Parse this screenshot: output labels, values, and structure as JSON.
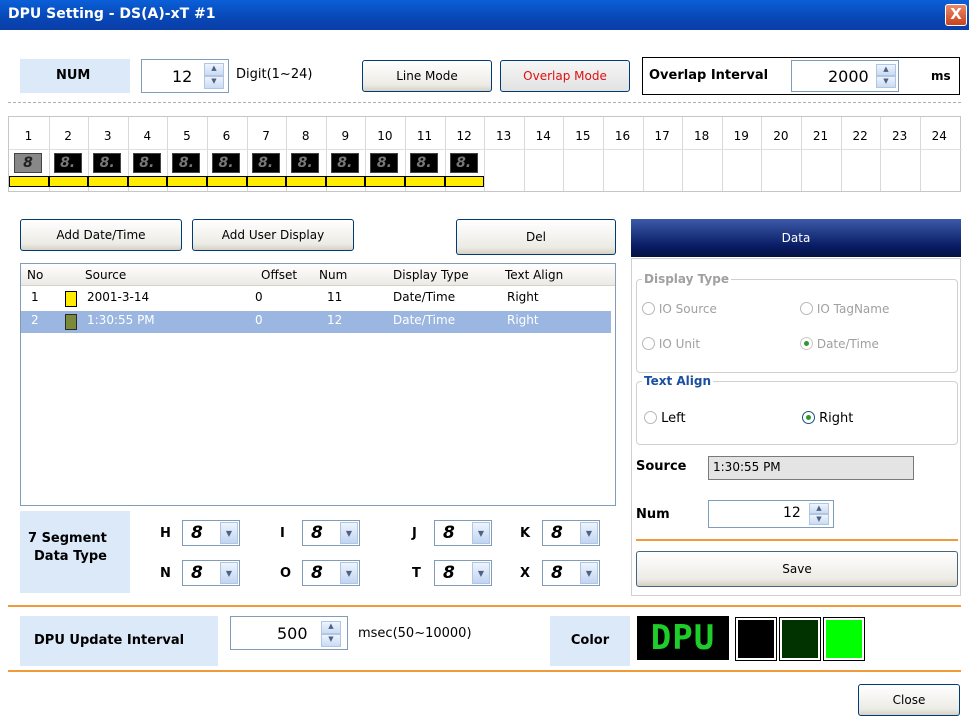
{
  "window": {
    "title": "DPU Setting - DS(A)-xT #1",
    "close": "X"
  },
  "top": {
    "num_label": "NUM",
    "num_value": "12",
    "digit_range": "Digit(1~24)",
    "line_mode": "Line Mode",
    "overlap_mode": "Overlap Mode",
    "overlap_interval_label": "Overlap Interval",
    "overlap_interval_value": "2000",
    "unit": "ms"
  },
  "digits": {
    "columns": [
      "1",
      "2",
      "3",
      "4",
      "5",
      "6",
      "7",
      "8",
      "9",
      "10",
      "11",
      "12",
      "13",
      "14",
      "15",
      "16",
      "17",
      "18",
      "19",
      "20",
      "21",
      "22",
      "23",
      "24"
    ],
    "segment_glyph": "8.",
    "first_glyph": "8",
    "active_count": 12
  },
  "buttons": {
    "add_datetime": "Add Date/Time",
    "add_user": "Add User Display",
    "del": "Del",
    "save": "Save",
    "close": "Close"
  },
  "list": {
    "headers": [
      "No",
      "Source",
      "Offset",
      "Num",
      "Display Type",
      "Text Align"
    ],
    "rows": [
      {
        "no": "1",
        "source": "2001-3-14",
        "offset": "0",
        "num": "11",
        "type": "Date/Time",
        "align": "Right"
      },
      {
        "no": "2",
        "source": "1:30:55 PM",
        "offset": "0",
        "num": "12",
        "type": "Date/Time",
        "align": "Right"
      }
    ]
  },
  "data_panel": {
    "header": "Data",
    "display_type": "Display Type",
    "io_source": "IO Source",
    "io_tagname": "IO TagName",
    "io_unit": "IO Unit",
    "datetime": "Date/Time",
    "text_align": "Text Align",
    "left": "Left",
    "right": "Right",
    "source_label": "Source",
    "source_value": "1:30:55 PM",
    "num_label": "Num",
    "num_value": "12"
  },
  "seg_type": {
    "label_line1": "7 Segment",
    "label_line2": "Data Type",
    "items": [
      {
        "key": "H",
        "glyph": "8"
      },
      {
        "key": "I",
        "glyph": "8"
      },
      {
        "key": "J",
        "glyph": "8"
      },
      {
        "key": "K",
        "glyph": "8"
      },
      {
        "key": "N",
        "glyph": "8"
      },
      {
        "key": "O",
        "glyph": "8"
      },
      {
        "key": "T",
        "glyph": "8"
      },
      {
        "key": "X",
        "glyph": "8"
      }
    ]
  },
  "bottom": {
    "update_label": "DPU Update Interval",
    "update_value": "500",
    "update_range": "msec(50~10000)",
    "color_label": "Color",
    "dpu_text": "DPU",
    "colors": {
      "swatch1": "#000000",
      "swatch2": "#003300",
      "swatch3": "#00ff00",
      "accent": "#f09a3a"
    }
  }
}
